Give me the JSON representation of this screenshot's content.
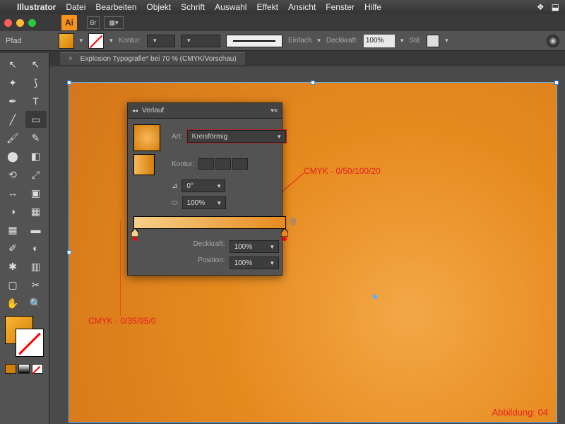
{
  "menubar": {
    "app": "Illustrator",
    "items": [
      "Datei",
      "Bearbeiten",
      "Objekt",
      "Schrift",
      "Auswahl",
      "Effekt",
      "Ansicht",
      "Fenster",
      "Hilfe"
    ]
  },
  "optbar": {
    "path_label": "Pfad",
    "kontur_label": "Kontur:",
    "stroke_pt": "",
    "deckkraft_label": "Deckkraft:",
    "deckkraft_val": "100%",
    "stil_label": "Stil:",
    "basic_line": "Einfach"
  },
  "tabs": {
    "doc": "Explosion Typografie* bei 70 % (CMYK/Vorschau)"
  },
  "panel": {
    "title": "Verlauf",
    "art_label": "Art:",
    "art_value": "Kreisförmig",
    "kontur_label": "Kontur:",
    "angle_label": "0°",
    "aspect_label": "100%",
    "opacity_label": "Deckkraft:",
    "opacity_val": "100%",
    "position_label": "Position:",
    "position_val": "100%"
  },
  "annotations": {
    "left_stop": "CMYK - 0/35/95/0",
    "right_stop": "CMYK - 0/50/100/20",
    "figure": "Abbildung: 04"
  }
}
